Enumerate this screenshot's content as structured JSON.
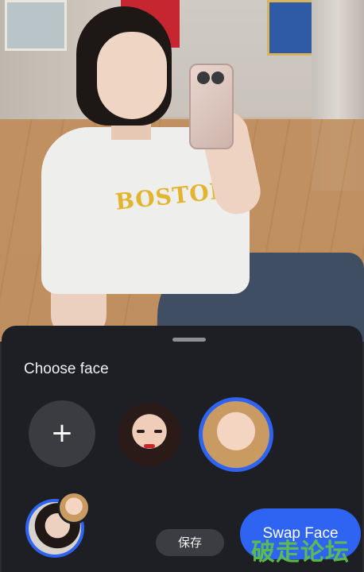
{
  "photo": {
    "print_text": "BOSTON"
  },
  "sheet": {
    "title": "Choose face",
    "add_symbol": "+",
    "save_label": "保存",
    "swap_label": "Swap Face"
  },
  "watermark": "破走论坛",
  "colors": {
    "accent": "#2f64f2",
    "sheet_bg": "#1d1f24",
    "button_gray": "#3b3d43"
  }
}
